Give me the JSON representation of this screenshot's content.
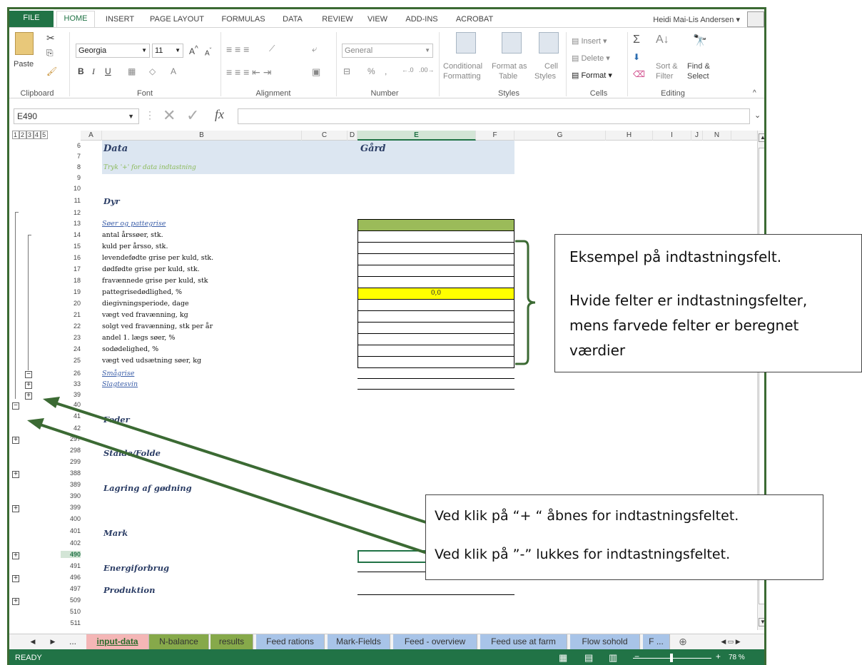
{
  "ribbon_tabs": [
    "FILE",
    "HOME",
    "INSERT",
    "PAGE LAYOUT",
    "FORMULAS",
    "DATA",
    "REVIEW",
    "VIEW",
    "ADD-INS",
    "ACROBAT"
  ],
  "user_name": "Heidi Mai-Lis Andersen",
  "clipboard": {
    "paste": "Paste",
    "group": "Clipboard"
  },
  "font": {
    "name": "Georgia",
    "size": "11",
    "group": "Font"
  },
  "alignment": {
    "group": "Alignment"
  },
  "number": {
    "format": "General",
    "group": "Number",
    "percent": "%",
    "comma": ","
  },
  "styles": {
    "conditional": "Conditional",
    "formatting": "Formatting",
    "format_as": "Format as",
    "table": "Table",
    "cell": "Cell",
    "cell_styles": "Styles",
    "group": "Styles"
  },
  "cells": {
    "insert": "Insert",
    "delete": "Delete",
    "format": "Format",
    "group": "Cells"
  },
  "editing": {
    "sort": "Sort &",
    "filter": "Filter",
    "find": "Find &",
    "select": "Select",
    "group": "Editing",
    "sigma": "Σ"
  },
  "formula_bar": {
    "name_box": "E490",
    "fx": "fx"
  },
  "outline_levels": [
    "1",
    "2",
    "3",
    "4",
    "5"
  ],
  "columns": [
    "A",
    "B",
    "C",
    "D",
    "E",
    "F",
    "G",
    "H",
    "I",
    "J",
    "N"
  ],
  "rows": [
    "6",
    "7",
    "8",
    "9",
    "10",
    "11",
    "12",
    "13",
    "14",
    "15",
    "16",
    "17",
    "18",
    "19",
    "20",
    "21",
    "22",
    "23",
    "24",
    "25",
    "26",
    "33",
    "39",
    "40",
    "41",
    "42",
    "297",
    "298",
    "299",
    "388",
    "389",
    "390",
    "399",
    "400",
    "401",
    "402",
    "490",
    "491",
    "496",
    "497",
    "509",
    "510",
    "511"
  ],
  "sheet": {
    "data_title": "Data",
    "gaard_title": "Gård",
    "hint": "Tryk '+' for data indtastning",
    "dyr": "Dyr",
    "soer_link": "Søer og pattegrise",
    "labels": [
      "antal årssøer, stk.",
      "kuld per årsso, stk.",
      "levendefødte grise per kuld, stk.",
      "dødfødte grise per kuld, stk.",
      "fravænnede grise per kuld, stk",
      "pattegrisedødlighed, %",
      "diegivningsperiode, dage",
      "vægt ved fravænning, kg",
      "solgt ved fravænning, stk per år",
      "andel 1. lægs søer, %",
      "sodødelighed, %",
      "vægt ved udsætning søer, kg"
    ],
    "calc_value": "0,0",
    "smaagrise": "Smågrise",
    "slagtesvin": "Slagtesvin",
    "foder": "Foder",
    "stalde": "Stalde/Folde",
    "lagring": "Lagring af gødning",
    "mark": "Mark",
    "energi": "Energiforbrug",
    "produktion": "Produktion"
  },
  "callout1": {
    "line1": "Eksempel på indtastningsfelt.",
    "line2": "Hvide felter er indtastningsfelter,",
    "line3": "mens farvede felter er beregnet",
    "line4": "værdier"
  },
  "callout2": {
    "line1": "Ved klik på “+ “ åbnes for indtastningsfeltet.",
    "line2": "Ved klik på ”-” lukkes for indtastningsfeltet."
  },
  "sheet_tabs": [
    "input-data",
    "N-balance",
    "results",
    "Feed rations",
    "Mark-Fields",
    "Feed - overview",
    "Feed use at farm",
    "Flow sohold",
    "F ..."
  ],
  "sheet_tab_colors": {
    "input": "#f4b6b6",
    "nbal": "#86a94a",
    "results": "#86a94a",
    "blue": "#a8c4e8"
  },
  "status": {
    "ready": "READY",
    "zoom": "78 %"
  },
  "expand_symbol": "+",
  "collapse_symbol": "−",
  "ellipsis": "..."
}
